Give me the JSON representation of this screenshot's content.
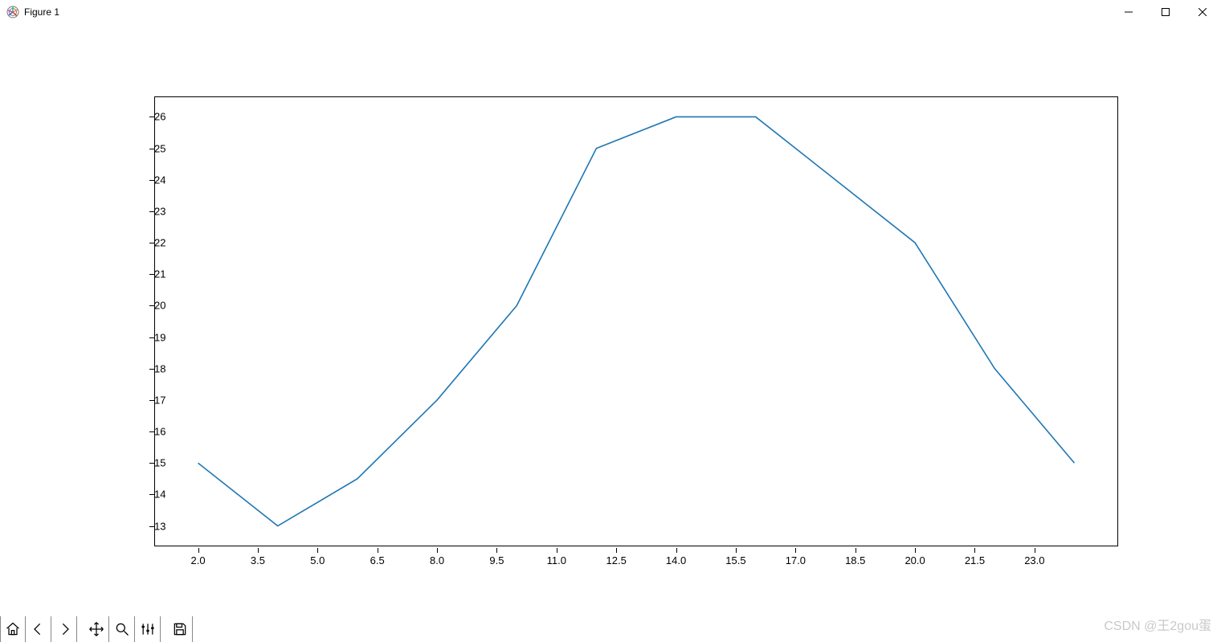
{
  "window": {
    "title": "Figure 1"
  },
  "watermark": "CSDN @王2gou蛋",
  "toolbar": {
    "items": [
      "home",
      "back",
      "forward",
      "pan",
      "zoom",
      "configure",
      "save"
    ]
  },
  "chart_data": {
    "type": "line",
    "x": [
      2,
      4,
      6,
      8,
      10,
      12,
      14,
      16,
      18,
      20,
      22,
      24
    ],
    "y": [
      15,
      13,
      14.5,
      17,
      20,
      25,
      26,
      26,
      24,
      22,
      18,
      15
    ],
    "xticks": [
      "2.0",
      "3.5",
      "5.0",
      "6.5",
      "8.0",
      "9.5",
      "11.0",
      "12.5",
      "14.0",
      "15.5",
      "17.0",
      "18.5",
      "20.0",
      "21.5",
      "23.0"
    ],
    "xtick_values": [
      2.0,
      3.5,
      5.0,
      6.5,
      8.0,
      9.5,
      11.0,
      12.5,
      14.0,
      15.5,
      17.0,
      18.5,
      20.0,
      21.5,
      23.0
    ],
    "yticks": [
      "13",
      "14",
      "15",
      "16",
      "17",
      "18",
      "19",
      "20",
      "21",
      "22",
      "23",
      "24",
      "25",
      "26"
    ],
    "ytick_values": [
      13,
      14,
      15,
      16,
      17,
      18,
      19,
      20,
      21,
      22,
      23,
      24,
      25,
      26
    ],
    "xlim": [
      0.9,
      25.1
    ],
    "ylim": [
      12.35,
      26.65
    ],
    "line_color": "#1f77b4",
    "title": "",
    "xlabel": "",
    "ylabel": ""
  }
}
